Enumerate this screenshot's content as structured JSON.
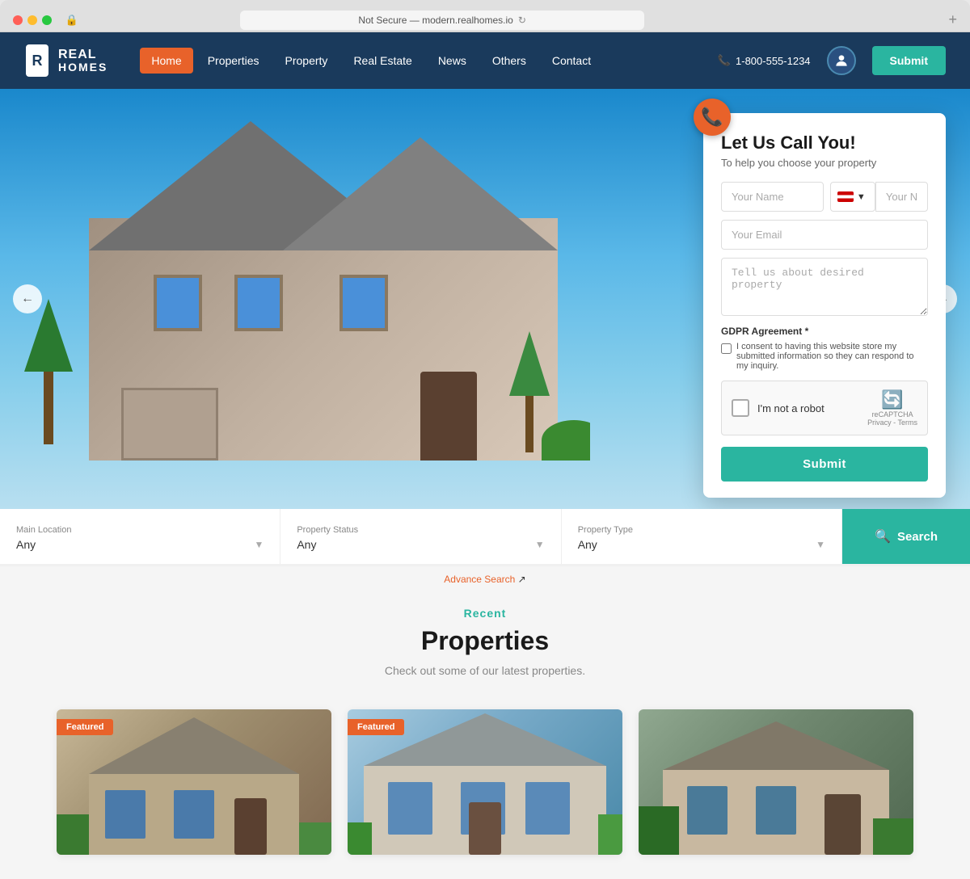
{
  "browser": {
    "url": "Not Secure — modern.realhomes.io",
    "reload_icon": "↻",
    "new_tab": "+"
  },
  "navbar": {
    "logo_real": "REAL",
    "logo_homes": "HOMES",
    "nav_items": [
      {
        "label": "Home",
        "active": true
      },
      {
        "label": "Properties",
        "active": false
      },
      {
        "label": "Property",
        "active": false
      },
      {
        "label": "Real Estate",
        "active": false
      },
      {
        "label": "News",
        "active": false
      },
      {
        "label": "Others",
        "active": false
      },
      {
        "label": "Contact",
        "active": false
      }
    ],
    "phone": "1-800-555-1234",
    "phone_icon": "📞",
    "submit_label": "Submit"
  },
  "call_form": {
    "icon": "📞",
    "title": "Let Us Call You!",
    "subtitle": "To help you choose your property",
    "name_placeholder": "Your Name",
    "number_placeholder": "Your Number",
    "email_placeholder": "Your Email",
    "message_placeholder": "Tell us about desired property",
    "gdpr_label": "GDPR Agreement *",
    "gdpr_text": "I consent to having this website store my submitted information so they can respond to my inquiry.",
    "recaptcha_label": "I'm not a robot",
    "recaptcha_brand": "reCAPTCHA",
    "recaptcha_links": "Privacy - Terms",
    "submit_label": "Submit"
  },
  "search_bar": {
    "location_label": "Main Location",
    "location_value": "Any",
    "status_label": "Property Status",
    "status_value": "Any",
    "type_label": "Property Type",
    "type_value": "Any",
    "search_label": "Search",
    "advance_label": "Advance Search"
  },
  "recent": {
    "eyebrow": "Recent",
    "title": "Properties",
    "subtitle": "Check out some of our latest properties.",
    "cards": [
      {
        "featured": true,
        "color": "warm"
      },
      {
        "featured": true,
        "color": "blue"
      },
      {
        "featured": false,
        "color": "green"
      }
    ]
  },
  "slider": {
    "prev_icon": "←",
    "next_icon": "→"
  }
}
